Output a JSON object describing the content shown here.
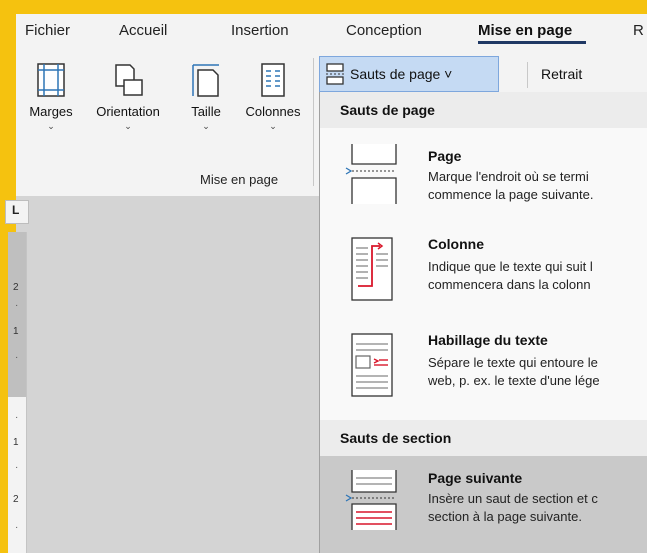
{
  "tabs": [
    {
      "label": "Fichier"
    },
    {
      "label": "Accueil"
    },
    {
      "label": "Insertion"
    },
    {
      "label": "Conception"
    },
    {
      "label": "Mise en page"
    },
    {
      "label": "R"
    }
  ],
  "ribbon": {
    "margins": "Marges",
    "orientation": "Orientation",
    "size": "Taille",
    "columns": "Colonnes",
    "group": "Mise en page",
    "breaks_button": "Sauts de page ˅",
    "indent": "Retrait"
  },
  "ruler": {
    "corner": "L",
    "num_2": "2",
    "num_1": "1",
    "num_1b": "1",
    "num_2b": "2"
  },
  "menu": {
    "page_breaks_header": "Sauts de page",
    "items": [
      {
        "title": "Page",
        "desc1": "Marque l'endroit où se termi",
        "desc2": "commence la page suivante."
      },
      {
        "title": "Colonne",
        "desc1": "Indique que le texte qui suit l",
        "desc2": "commencera dans la colonn"
      },
      {
        "title": "Habillage du texte",
        "desc1": "Sépare le texte qui entoure le",
        "desc2": "web, p. ex. le texte d'une lége"
      }
    ],
    "section_breaks_header": "Sauts de section",
    "section_items": [
      {
        "title": "Page suivante",
        "desc1": "Insère un saut de section et c",
        "desc2": "section à la page suivante."
      }
    ]
  },
  "colors": {
    "accent": "#f5c20f",
    "break_red": "#d9172b",
    "tab_underline": "#1f3864"
  }
}
